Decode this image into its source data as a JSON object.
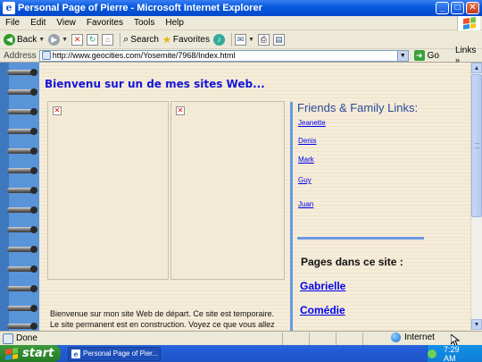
{
  "window": {
    "title": "Personal Page of Pierre - Microsoft Internet Explorer",
    "minimize_glyph": "_",
    "maximize_glyph": "□",
    "close_glyph": "✕"
  },
  "menu": {
    "items": [
      "File",
      "Edit",
      "View",
      "Favorites",
      "Tools",
      "Help"
    ]
  },
  "toolbar": {
    "back_label": "Back",
    "search_label": "Search",
    "favorites_label": "Favorites"
  },
  "address": {
    "label": "Address",
    "url": "http://www.geocities.com/Yosemite/7968/Index.html",
    "go_label": "Go",
    "links_label": "Links"
  },
  "page": {
    "heading": "Bienvenu sur un de mes sites Web...",
    "intro_text": "Bienvenue sur mon site Web de départ. Ce site est temporaire. Le site permanent est en construction. Voyez ce que vous allez pouvoir",
    "friends_heading": "Friends & Family Links:",
    "friends_links": [
      "Jeanette",
      "Denis",
      "Mark",
      "Guy",
      "Juan"
    ],
    "pages_heading": "Pages dans ce site :",
    "pages_links": [
      "Gabrielle",
      "Comédie"
    ],
    "broken_image_glyph": "✕"
  },
  "status": {
    "text": "Done",
    "zone": "Internet"
  },
  "taskbar": {
    "start_label": "start",
    "task_label": "Personal Page of Pier...",
    "clock": "7:29 AM"
  },
  "colors": {
    "heading": "#1515d8",
    "link": "#0000ee",
    "divider": "#6a9ae0",
    "page_bg": "#f5ecd9"
  }
}
